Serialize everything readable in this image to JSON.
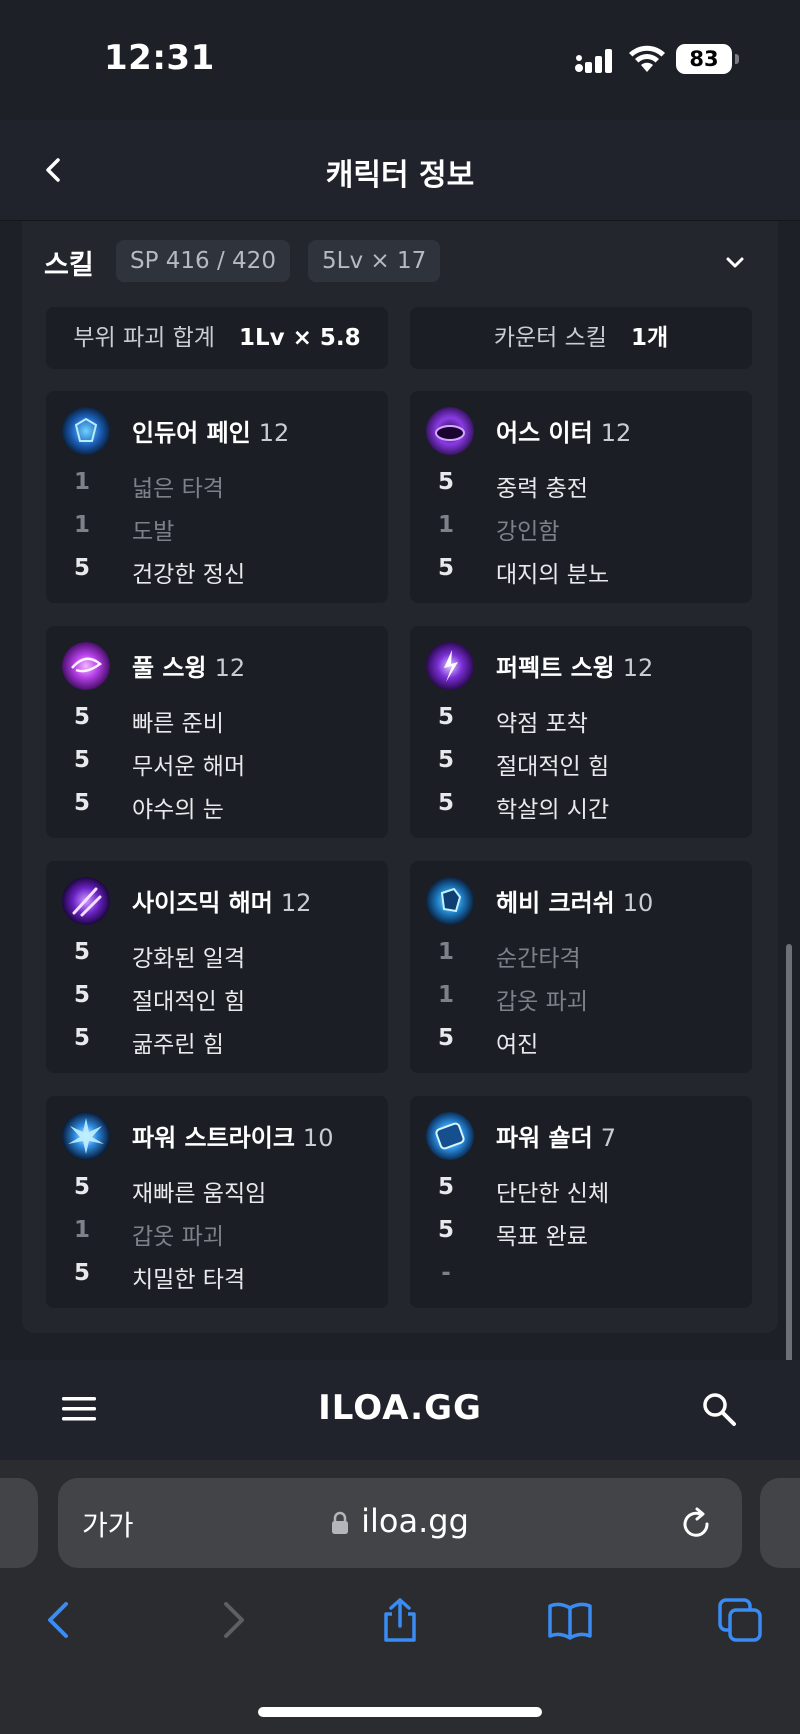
{
  "status": {
    "time": "12:31",
    "battery": "83"
  },
  "header": {
    "title": "캐릭터 정보"
  },
  "skills": {
    "title": "스킬",
    "sp": "SP 416 / 420",
    "lv": "5Lv × 17",
    "summary_left_label": "부위 파괴 합계",
    "summary_left_value": "1Lv × 5.8",
    "summary_right_label": "카운터 스킬",
    "summary_right_value": "1개",
    "cards": [
      {
        "name": "인듀어 페인",
        "level": "12",
        "icon": "blue-shield-icon",
        "tripods": [
          {
            "n": "1",
            "t": "넓은 타격"
          },
          {
            "n": "1",
            "t": "도발"
          },
          {
            "n": "5",
            "t": "건강한 정신"
          }
        ]
      },
      {
        "name": "어스 이터",
        "level": "12",
        "icon": "purple-vortex-icon",
        "tripods": [
          {
            "n": "5",
            "t": "중력 충전"
          },
          {
            "n": "1",
            "t": "강인함"
          },
          {
            "n": "5",
            "t": "대지의 분노"
          }
        ]
      },
      {
        "name": "풀 스윙",
        "level": "12",
        "icon": "purple-swirl-icon",
        "tripods": [
          {
            "n": "5",
            "t": "빠른 준비"
          },
          {
            "n": "5",
            "t": "무서운 해머"
          },
          {
            "n": "5",
            "t": "야수의 눈"
          }
        ]
      },
      {
        "name": "퍼펙트 스윙",
        "level": "12",
        "icon": "purple-lightning-icon",
        "tripods": [
          {
            "n": "5",
            "t": "약점 포착"
          },
          {
            "n": "5",
            "t": "절대적인 힘"
          },
          {
            "n": "5",
            "t": "학살의 시간"
          }
        ]
      },
      {
        "name": "사이즈믹 해머",
        "level": "12",
        "icon": "purple-hammer-icon",
        "tripods": [
          {
            "n": "5",
            "t": "강화된 일격"
          },
          {
            "n": "5",
            "t": "절대적인 힘"
          },
          {
            "n": "5",
            "t": "굶주린 힘"
          }
        ]
      },
      {
        "name": "헤비 크러쉬",
        "level": "10",
        "icon": "blue-cube-icon",
        "tripods": [
          {
            "n": "1",
            "t": "순간타격"
          },
          {
            "n": "1",
            "t": "갑옷 파괴"
          },
          {
            "n": "5",
            "t": "여진"
          }
        ]
      },
      {
        "name": "파워 스트라이크",
        "level": "10",
        "icon": "blue-burst-icon",
        "tripods": [
          {
            "n": "5",
            "t": "재빠른 움직임"
          },
          {
            "n": "1",
            "t": "갑옷 파괴"
          },
          {
            "n": "5",
            "t": "치밀한 타격"
          }
        ]
      },
      {
        "name": "파워 숄더",
        "level": "7",
        "icon": "blue-crystal-icon",
        "tripods": [
          {
            "n": "5",
            "t": "단단한 신체"
          },
          {
            "n": "5",
            "t": "목표 완료"
          },
          {
            "n": "-",
            "t": ""
          }
        ]
      }
    ]
  },
  "site_nav": {
    "logo": "ILOA.GG"
  },
  "browser": {
    "aa": "가가",
    "url": "iloa.gg"
  }
}
